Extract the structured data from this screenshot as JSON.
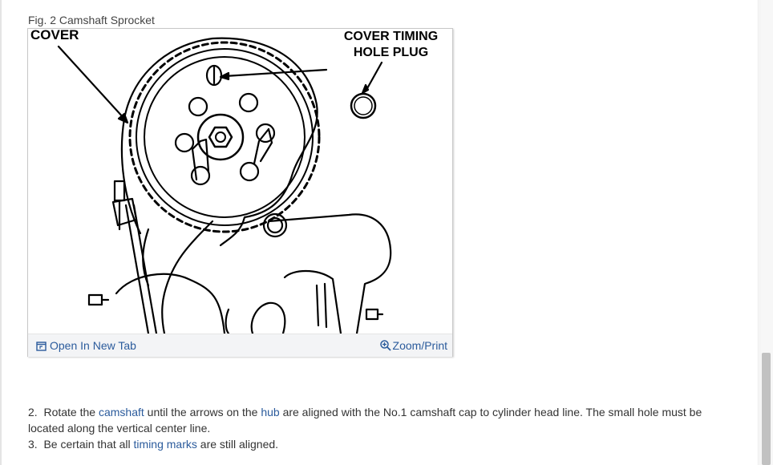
{
  "figure": {
    "caption": "Fig. 2 Camshaft Sprocket",
    "labels": {
      "cover": "COVER",
      "plug_line1": "COVER TIMING",
      "plug_line2": "HOLE PLUG"
    },
    "toolbar": {
      "open_new_tab": "Open In New Tab",
      "zoom_print": "Zoom/Print",
      "open_icon": "external-window-icon",
      "zoom_icon": "magnifier-plus-icon"
    }
  },
  "steps": [
    {
      "number": "2.",
      "t1": "Rotate the",
      "link1": "camshaft",
      "t2": "until the arrows on the",
      "link2": "hub",
      "t3": "are aligned with the No.1 camshaft cap to cylinder head line. The small hole must be located along the vertical center line."
    },
    {
      "number": "3.",
      "t1": "Be certain that all",
      "link1": "timing marks",
      "t2": "are still aligned."
    }
  ],
  "colors": {
    "link": "#2b5b9c",
    "text": "#333333",
    "toolbar_bg": "#f3f4f6"
  }
}
